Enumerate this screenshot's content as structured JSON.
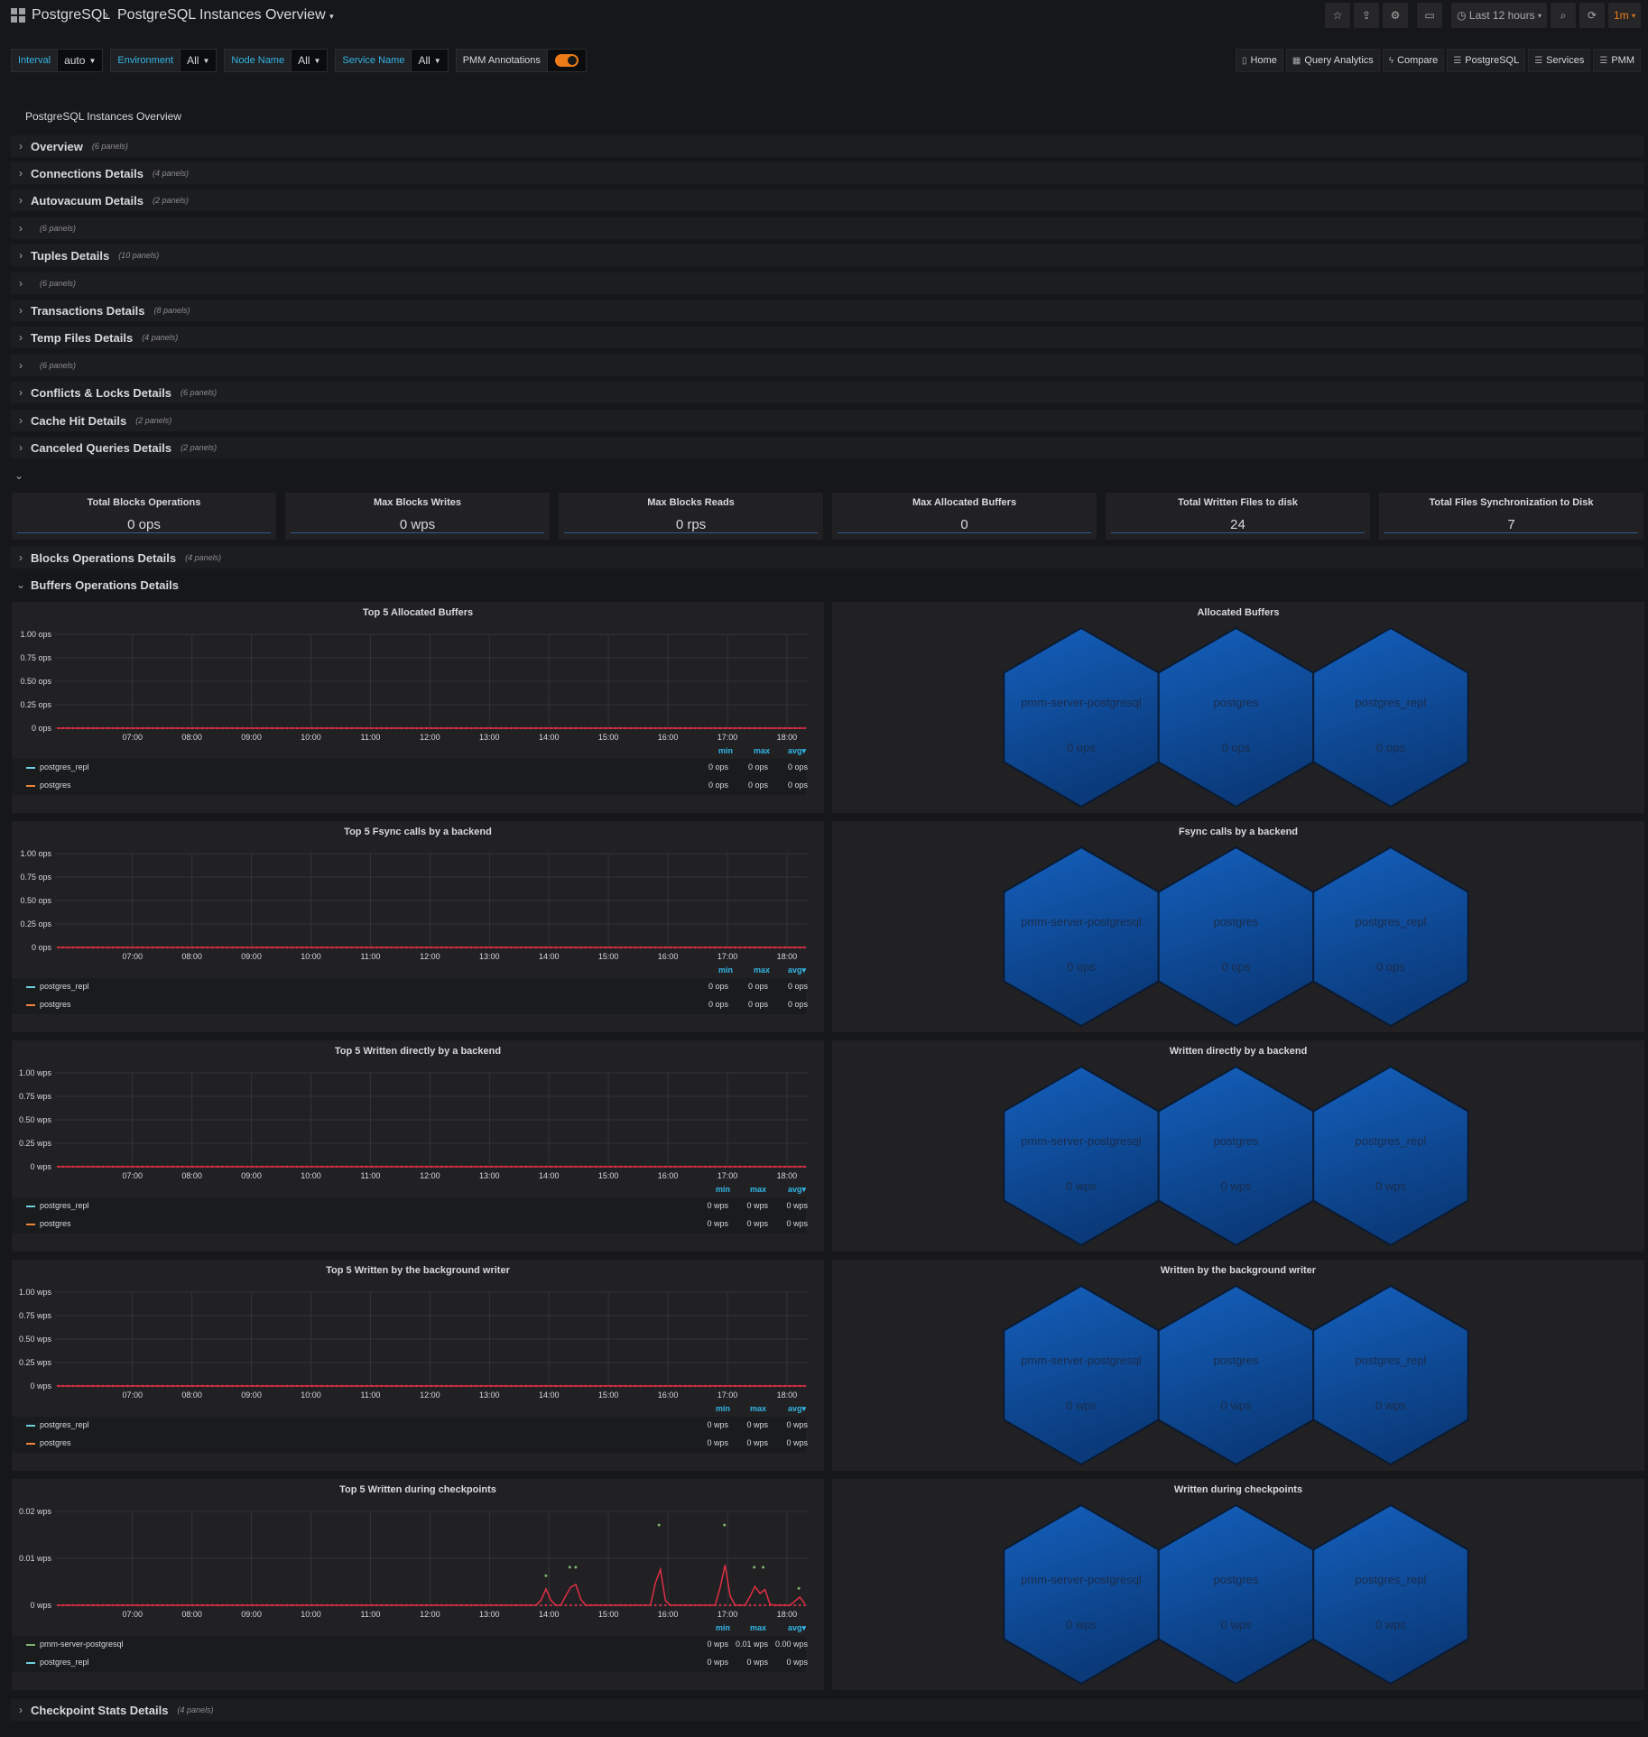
{
  "breadcrumb": {
    "folder": "PostgreSQL",
    "dashboard": "PostgreSQL Instances Overview"
  },
  "toolbar": {
    "time_range": "Last 12 hours",
    "refresh": "1m"
  },
  "variables": [
    {
      "label": "Interval",
      "value": "auto"
    },
    {
      "label": "Environment",
      "value": "All"
    },
    {
      "label": "Node Name",
      "value": "All"
    },
    {
      "label": "Service Name",
      "value": "All"
    }
  ],
  "annotations_toggle": {
    "label": "PMM Annotations",
    "on": true
  },
  "nav_links": [
    "Home",
    "Query Analytics",
    "Compare",
    "PostgreSQL",
    "Services",
    "PMM"
  ],
  "dashboard_title": "PostgreSQL Instances Overview",
  "rows": [
    {
      "title": "Overview",
      "count": "(6 panels)"
    },
    {
      "title": "Connections Details",
      "count": "(4 panels)"
    },
    {
      "title": "Autovacuum Details",
      "count": "(2 panels)"
    },
    {
      "title": "",
      "count": "(6 panels)"
    },
    {
      "title": "Tuples Details",
      "count": "(10 panels)"
    },
    {
      "title": "",
      "count": "(6 panels)"
    },
    {
      "title": "Transactions Details",
      "count": "(8 panels)"
    },
    {
      "title": "Temp Files Details",
      "count": "(4 panels)"
    },
    {
      "title": "",
      "count": "(6 panels)"
    },
    {
      "title": "Conflicts & Locks Details",
      "count": "(6 panels)"
    },
    {
      "title": "Cache Hit Details",
      "count": "(2 panels)"
    },
    {
      "title": "Canceled Queries Details",
      "count": "(2 panels)"
    }
  ],
  "stats": [
    {
      "title": "Total Blocks Operations",
      "value": "0 ops"
    },
    {
      "title": "Max Blocks Writes",
      "value": "0 wps"
    },
    {
      "title": "Max Blocks Reads",
      "value": "0 rps"
    },
    {
      "title": "Max Allocated Buffers",
      "value": "0"
    },
    {
      "title": "Total Written Files to disk",
      "value": "24"
    },
    {
      "title": "Total Files Synchronization to Disk",
      "value": "7"
    }
  ],
  "row_blocks": {
    "title": "Blocks Operations Details",
    "count": "(4 panels)"
  },
  "row_buffers": {
    "title": "Buffers Operations Details"
  },
  "row_checkpoint": {
    "title": "Checkpoint Stats Details",
    "count": "(4 panels)"
  },
  "legend_headers": {
    "min": "min",
    "max": "max",
    "avg": "avg"
  },
  "colors": {
    "postgres_repl": "#6ed0e0",
    "postgres": "#ef843c",
    "pmm-server-postgresql": "#7eb26d",
    "series_line": "#e02f44",
    "hex": "#0d4a94"
  },
  "chart_data": [
    {
      "type": "line",
      "title": "Top 5 Allocated Buffers",
      "unit": "ops",
      "yticks": [
        "1.00 ops",
        "0.75 ops",
        "0.50 ops",
        "0.25 ops",
        "0 ops"
      ],
      "ylim": [
        0,
        1
      ],
      "x": [
        "07:00",
        "08:00",
        "09:00",
        "10:00",
        "11:00",
        "12:00",
        "13:00",
        "14:00",
        "15:00",
        "16:00",
        "17:00",
        "18:00"
      ],
      "series": [
        {
          "name": "postgres_repl",
          "min": "0 ops",
          "max": "0 ops",
          "avg": "0 ops"
        },
        {
          "name": "postgres",
          "min": "0 ops",
          "max": "0 ops",
          "avg": "0 ops"
        }
      ],
      "spikes": []
    },
    {
      "type": "line",
      "title": "Top 5 Fsync calls by a backend",
      "unit": "ops",
      "yticks": [
        "1.00 ops",
        "0.75 ops",
        "0.50 ops",
        "0.25 ops",
        "0 ops"
      ],
      "ylim": [
        0,
        1
      ],
      "x": [
        "07:00",
        "08:00",
        "09:00",
        "10:00",
        "11:00",
        "12:00",
        "13:00",
        "14:00",
        "15:00",
        "16:00",
        "17:00",
        "18:00"
      ],
      "series": [
        {
          "name": "postgres_repl",
          "min": "0 ops",
          "max": "0 ops",
          "avg": "0 ops"
        },
        {
          "name": "postgres",
          "min": "0 ops",
          "max": "0 ops",
          "avg": "0 ops"
        }
      ],
      "spikes": []
    },
    {
      "type": "line",
      "title": "Top 5 Written directly by a backend",
      "unit": "wps",
      "yticks": [
        "1.00 wps",
        "0.75 wps",
        "0.50 wps",
        "0.25 wps",
        "0 wps"
      ],
      "ylim": [
        0,
        1
      ],
      "x": [
        "07:00",
        "08:00",
        "09:00",
        "10:00",
        "11:00",
        "12:00",
        "13:00",
        "14:00",
        "15:00",
        "16:00",
        "17:00",
        "18:00"
      ],
      "series": [
        {
          "name": "postgres_repl",
          "min": "0 wps",
          "max": "0 wps",
          "avg": "0 wps"
        },
        {
          "name": "postgres",
          "min": "0 wps",
          "max": "0 wps",
          "avg": "0 wps"
        }
      ],
      "spikes": []
    },
    {
      "type": "line",
      "title": "Top 5 Written by the background writer",
      "unit": "wps",
      "yticks": [
        "1.00 wps",
        "0.75 wps",
        "0.50 wps",
        "0.25 wps",
        "0 wps"
      ],
      "ylim": [
        0,
        1
      ],
      "x": [
        "07:00",
        "08:00",
        "09:00",
        "10:00",
        "11:00",
        "12:00",
        "13:00",
        "14:00",
        "15:00",
        "16:00",
        "17:00",
        "18:00"
      ],
      "series": [
        {
          "name": "postgres_repl",
          "min": "0 wps",
          "max": "0 wps",
          "avg": "0 wps"
        },
        {
          "name": "postgres",
          "min": "0 wps",
          "max": "0 wps",
          "avg": "0 wps"
        }
      ],
      "spikes": []
    },
    {
      "type": "line",
      "title": "Top 5 Written during checkpoints",
      "unit": "wps",
      "yticks": [
        "0.02 wps",
        "0.01 wps",
        "0 wps"
      ],
      "ylim": [
        0,
        0.02
      ],
      "x": [
        "07:00",
        "08:00",
        "09:00",
        "10:00",
        "11:00",
        "12:00",
        "13:00",
        "14:00",
        "15:00",
        "16:00",
        "17:00",
        "18:00"
      ],
      "series": [
        {
          "name": "pmm-server-postgresql",
          "min": "0 wps",
          "max": "0.01 wps",
          "avg": "0.00 wps"
        },
        {
          "name": "postgres_repl",
          "min": "0 wps",
          "max": "0 wps",
          "avg": "0 wps"
        }
      ],
      "spikes": [
        {
          "t": 13.95,
          "v": 0.0035
        },
        {
          "t": 14.35,
          "v": 0.0045
        },
        {
          "t": 14.45,
          "v": 0.0045
        },
        {
          "t": 15.85,
          "v": 0.0095
        },
        {
          "t": 16.95,
          "v": 0.0095
        },
        {
          "t": 17.45,
          "v": 0.0045
        },
        {
          "t": 17.6,
          "v": 0.0045
        },
        {
          "t": 18.2,
          "v": 0.002
        }
      ]
    }
  ],
  "hex_panels": [
    {
      "title": "Allocated Buffers",
      "cells": [
        {
          "name": "pmm-server-postgresql",
          "value": "0 ops"
        },
        {
          "name": "postgres",
          "value": "0 ops"
        },
        {
          "name": "postgres_repl",
          "value": "0 ops"
        }
      ]
    },
    {
      "title": "Fsync calls by a backend",
      "cells": [
        {
          "name": "pmm-server-postgresql",
          "value": "0 ops"
        },
        {
          "name": "postgres",
          "value": "0 ops"
        },
        {
          "name": "postgres_repl",
          "value": "0 ops"
        }
      ]
    },
    {
      "title": "Written directly by a backend",
      "cells": [
        {
          "name": "pmm-server-postgresql",
          "value": "0 wps"
        },
        {
          "name": "postgres",
          "value": "0 wps"
        },
        {
          "name": "postgres_repl",
          "value": "0 wps"
        }
      ]
    },
    {
      "title": "Written by the background writer",
      "cells": [
        {
          "name": "pmm-server-postgresql",
          "value": "0 wps"
        },
        {
          "name": "postgres",
          "value": "0 wps"
        },
        {
          "name": "postgres_repl",
          "value": "0 wps"
        }
      ]
    },
    {
      "title": "Written during checkpoints",
      "cells": [
        {
          "name": "pmm-server-postgresql",
          "value": "0 wps"
        },
        {
          "name": "postgres",
          "value": "0 wps"
        },
        {
          "name": "postgres_repl",
          "value": "0 wps"
        }
      ]
    }
  ]
}
